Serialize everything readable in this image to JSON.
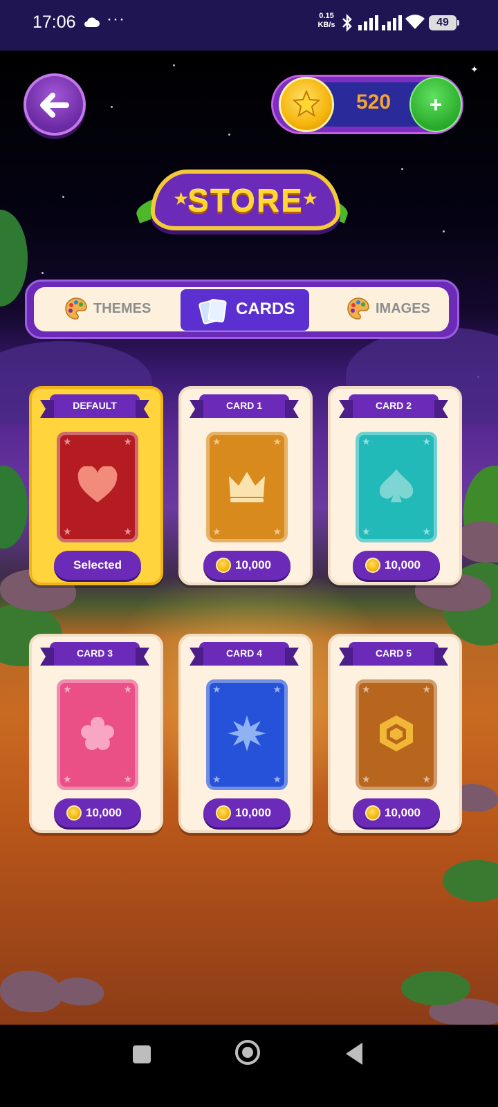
{
  "status_bar": {
    "time": "17:06",
    "dots": "···",
    "speed_value": "0.15",
    "speed_unit": "KB/s",
    "battery": "49"
  },
  "header": {
    "coins": "520",
    "add_symbol": "+"
  },
  "banner": {
    "title": "STORE"
  },
  "tabs": [
    {
      "label": "THEMES",
      "active": false
    },
    {
      "label": "CARDS",
      "active": true
    },
    {
      "label": "IMAGES",
      "active": false
    }
  ],
  "cards": [
    {
      "name": "DEFAULT",
      "status": "Selected",
      "color": "#b51c22",
      "icon": "heart-icon"
    },
    {
      "name": "CARD 1",
      "price": "10,000",
      "color": "#d98a1c",
      "icon": "crown-icon"
    },
    {
      "name": "CARD 2",
      "price": "10,000",
      "color": "#22b9b9",
      "icon": "spade-icon"
    },
    {
      "name": "CARD 3",
      "price": "10,000",
      "color": "#ea4f86",
      "icon": "flower-icon"
    },
    {
      "name": "CARD 4",
      "price": "10,000",
      "color": "#2552d8",
      "icon": "star-burst-icon"
    },
    {
      "name": "CARD 5",
      "price": "10,000",
      "color": "#b8661e",
      "icon": "hexagon-icon"
    }
  ],
  "colors": {
    "accent_purple": "#6b2ab8",
    "coin_gold": "#f5b50d",
    "selected_yellow": "#ffd43d",
    "add_green": "#2aaa2a"
  }
}
